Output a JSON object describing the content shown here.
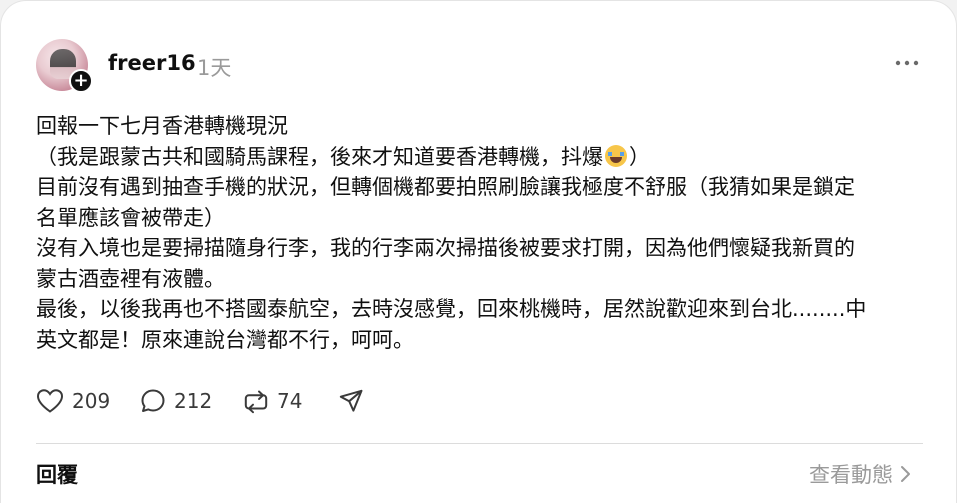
{
  "post": {
    "username": "freer16",
    "time_ago": "1天",
    "lines": [
      "回報一下七月香港轉機現況",
      "（我是跟蒙古共和國騎馬課程，後來才知道要香港轉機，抖爆",
      "目前沒有遇到抽查手機的狀況，但轉個機都要拍照刷臉讓我極度不舒服（我猜如果是鎖定",
      "名單應該會被帶走）",
      "沒有入境也是要掃描隨身行李，我的行李兩次掃描後被要求打開，因為他們懷疑我新買的",
      "蒙古酒壺裡有液體。",
      "最後，以後我再也不搭國泰航空，去時沒感覺，回來桃機時，居然說歡迎來到台北........中",
      "英文都是！原來連說台灣都不行，呵呵。"
    ],
    "line2_suffix": "）",
    "emoji_name": "loudly-crying-face-emoji"
  },
  "actions": {
    "likes": "209",
    "comments": "212",
    "reposts": "74"
  },
  "footer": {
    "reply_label": "回覆",
    "view_activity_label": "查看動態"
  },
  "colors": {
    "text": "#101010",
    "muted": "#9a9a9a",
    "background": "#ffffff"
  }
}
